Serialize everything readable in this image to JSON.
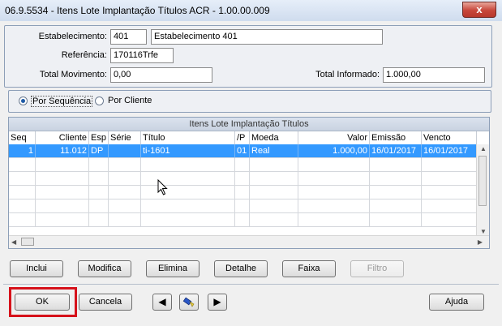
{
  "window": {
    "title": "06.9.5534 - Itens Lote Implantação Títulos ACR - 1.00.00.009",
    "close_glyph": "x"
  },
  "form": {
    "estabelecimento_label": "Estabelecimento:",
    "estabelecimento_code": "401",
    "estabelecimento_name": "Estabelecimento 401",
    "referencia_label": "Referência:",
    "referencia_value": "170116Trfe",
    "total_movimento_label": "Total Movimento:",
    "total_movimento_value": "0,00",
    "total_informado_label": "Total Informado:",
    "total_informado_value": "1.000,00"
  },
  "sort_options": {
    "selected": "Por Sequência",
    "options": [
      "Por Sequência",
      "Por Cliente"
    ]
  },
  "table": {
    "title": "Itens Lote Implantação Títulos",
    "columns": [
      "Seq",
      "Cliente",
      "Esp",
      "Série",
      "Título",
      "/P",
      "Moeda",
      "Valor",
      "Emissão",
      "Vencto"
    ],
    "rows": [
      {
        "seq": "1",
        "cliente": "11.012",
        "esp": "DP",
        "serie": "",
        "titulo": "ti-1601",
        "p": "01",
        "moeda": "Real",
        "valor": "1.000,00",
        "emissao": "16/01/2017",
        "vencto": "16/01/2017",
        "selected": true
      }
    ]
  },
  "actions": {
    "inclui": "Inclui",
    "modifica": "Modifica",
    "elimina": "Elimina",
    "detalhe": "Detalhe",
    "faixa": "Faixa",
    "filtro": "Filtro"
  },
  "footer": {
    "ok": "OK",
    "cancela": "Cancela",
    "ajuda": "Ajuda",
    "prev_glyph": "◀",
    "next_glyph": "▶"
  },
  "colors": {
    "selection": "#3399ff",
    "highlight_box": "#d6121b"
  }
}
